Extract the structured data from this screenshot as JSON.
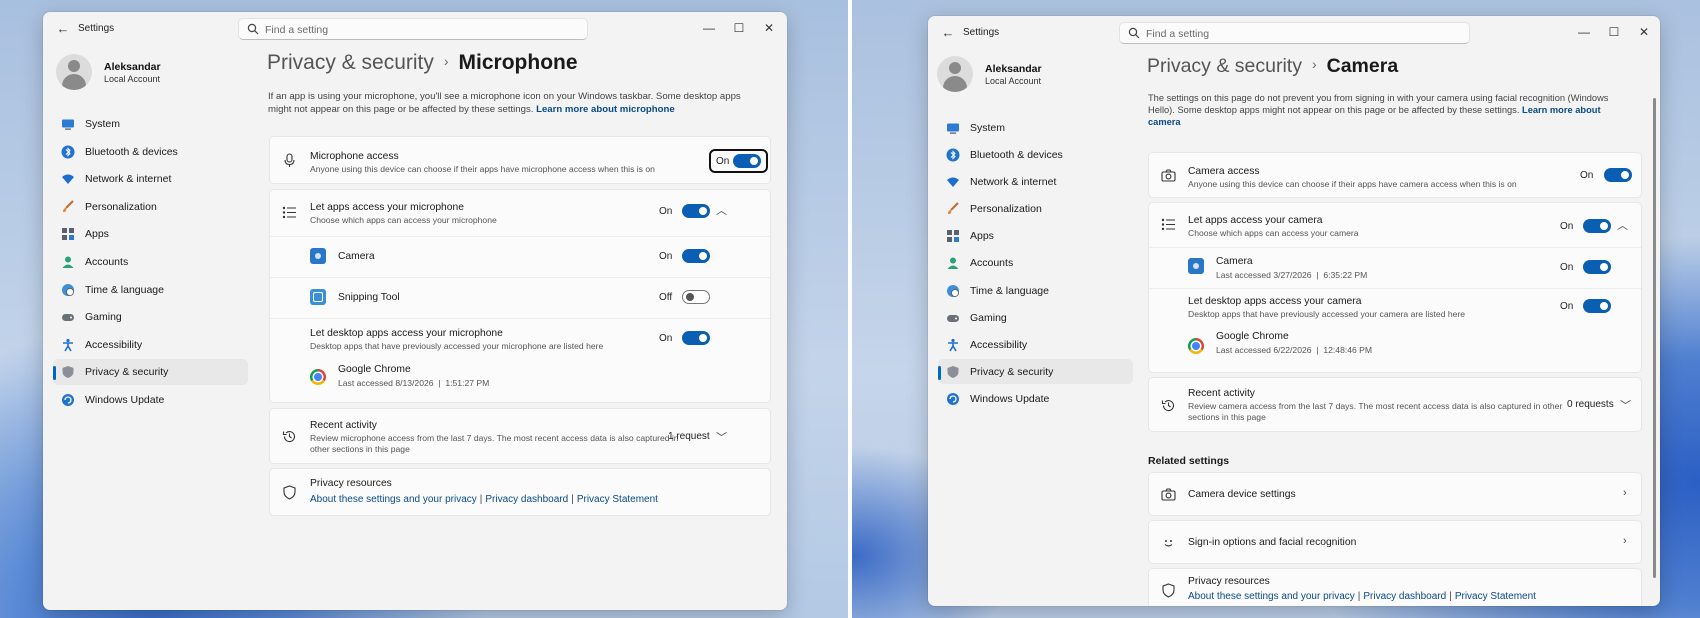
{
  "left": {
    "app_title": "Settings",
    "search_placeholder": "Find a setting",
    "profile": {
      "name": "Aleksandar",
      "account": "Local Account"
    },
    "nav": [
      {
        "label": "System",
        "icon": "monitor-icon"
      },
      {
        "label": "Bluetooth & devices",
        "icon": "bluetooth-icon"
      },
      {
        "label": "Network & internet",
        "icon": "wifi-icon"
      },
      {
        "label": "Personalization",
        "icon": "brush-icon"
      },
      {
        "label": "Apps",
        "icon": "apps-icon"
      },
      {
        "label": "Accounts",
        "icon": "person-icon"
      },
      {
        "label": "Time & language",
        "icon": "globe-clock-icon"
      },
      {
        "label": "Gaming",
        "icon": "gamepad-icon"
      },
      {
        "label": "Accessibility",
        "icon": "accessibility-icon"
      },
      {
        "label": "Privacy & security",
        "icon": "shield-icon",
        "selected": true
      },
      {
        "label": "Windows Update",
        "icon": "update-icon"
      }
    ],
    "breadcrumb_parent": "Privacy & security",
    "breadcrumb_sep": "›",
    "breadcrumb_current": "Microphone",
    "intro_text": "If an app is using your microphone, you'll see a microphone icon on your Windows taskbar. Some desktop apps might not appear on this page or be affected by these settings.",
    "intro_link": "Learn more about microphone",
    "mic_access": {
      "title": "Microphone access",
      "desc": "Anyone using this device can choose if their apps have microphone access when this is on",
      "state": "On"
    },
    "let_apps": {
      "title": "Let apps access your microphone",
      "desc": "Choose which apps can access your microphone",
      "state": "On"
    },
    "apps": [
      {
        "name": "Camera",
        "state": "On"
      },
      {
        "name": "Snipping Tool",
        "state": "Off"
      }
    ],
    "desktop": {
      "title": "Let desktop apps access your microphone",
      "desc": "Desktop apps that have previously accessed your microphone are listed here",
      "state": "On"
    },
    "chrome": {
      "name": "Google Chrome",
      "last": "Last accessed 8/13/2026  |  1:51:27 PM"
    },
    "recent": {
      "title": "Recent activity",
      "desc1": "Review microphone access from the last 7 days. The most recent access data is also captured in",
      "desc2": "other sections in this page",
      "count": "1 request"
    },
    "resources": {
      "title": "Privacy resources",
      "link1": "About these settings and your privacy",
      "link2": "Privacy dashboard",
      "link3": "Privacy Statement",
      "pipe": "|"
    }
  },
  "right": {
    "app_title": "Settings",
    "search_placeholder": "Find a setting",
    "profile": {
      "name": "Aleksandar",
      "account": "Local Account"
    },
    "nav": [
      {
        "label": "System"
      },
      {
        "label": "Bluetooth & devices"
      },
      {
        "label": "Network & internet"
      },
      {
        "label": "Personalization"
      },
      {
        "label": "Apps"
      },
      {
        "label": "Accounts"
      },
      {
        "label": "Time & language"
      },
      {
        "label": "Gaming"
      },
      {
        "label": "Accessibility"
      },
      {
        "label": "Privacy & security",
        "selected": true
      },
      {
        "label": "Windows Update"
      }
    ],
    "breadcrumb_parent": "Privacy & security",
    "breadcrumb_sep": "›",
    "breadcrumb_current": "Camera",
    "intro_text1": "The settings on this page do not prevent you from signing in with your camera using facial recognition (Windows",
    "intro_text2": "Hello). Some desktop apps might not appear on this page or be affected by these settings.",
    "intro_link1": "Learn more about",
    "intro_link2": "camera",
    "cam_access": {
      "title": "Camera access",
      "desc": "Anyone using this device can choose if their apps have camera access when this is on",
      "state": "On"
    },
    "let_apps": {
      "title": "Let apps access your camera",
      "desc": "Choose which apps can access your camera",
      "state": "On"
    },
    "camera_app": {
      "name": "Camera",
      "last": "Last accessed 3/27/2026  |  6:35:22 PM",
      "state": "On"
    },
    "desktop": {
      "title": "Let desktop apps access your camera",
      "desc": "Desktop apps that have previously accessed your camera are listed here",
      "state": "On"
    },
    "chrome": {
      "name": "Google Chrome",
      "last": "Last accessed 6/22/2026  |  12:48:46 PM"
    },
    "recent": {
      "title": "Recent activity",
      "desc1": "Review camera access from the last 7 days. The most recent access data is also captured in other",
      "desc2": "sections in this page",
      "count": "0 requests"
    },
    "related_heading": "Related settings",
    "related": [
      {
        "label": "Camera device settings"
      },
      {
        "label": "Sign-in options and facial recognition"
      }
    ],
    "resources": {
      "title": "Privacy resources",
      "link1": "About these settings and your privacy",
      "link2": "Privacy dashboard",
      "link3": "Privacy Statement",
      "pipe": "|"
    }
  },
  "colors": {
    "accent": "#0a5fb4",
    "link": "#0a4a86"
  }
}
